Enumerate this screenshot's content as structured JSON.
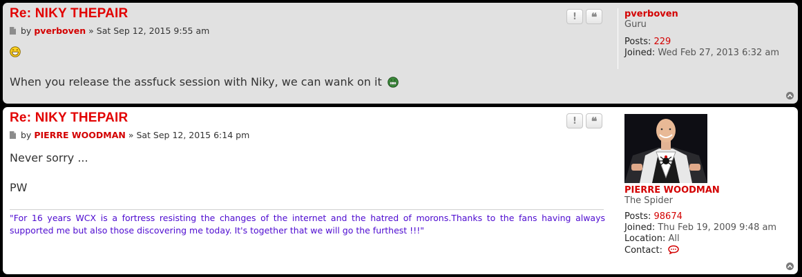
{
  "posts": [
    {
      "title": "Re: NIKY THEPAIR",
      "by": "by",
      "author": "pverboven",
      "date": "» Sat Sep 12, 2015 9:55 am",
      "content": [
        "When you release the assfuck session with Niky, we can wank on it"
      ],
      "profile": {
        "name": "pverboven",
        "rank": "Guru",
        "posts_label": "Posts:",
        "posts_value": "229",
        "joined_label": "Joined:",
        "joined_value": "Wed Feb 27, 2013 6:32 am"
      }
    },
    {
      "title": "Re: NIKY THEPAIR",
      "by": "by",
      "author": "PIERRE WOODMAN",
      "date": "» Sat Sep 12, 2015 6:14 pm",
      "content": [
        "Never sorry ...",
        "PW"
      ],
      "signature": "\"For 16 years WCX is a fortress resisting the changes of the internet and the hatred of morons.Thanks to the fans having always supported me but also those discovering me today. It's together that we will go the furthest !!!\"",
      "profile": {
        "name": "PIERRE WOODMAN",
        "rank": "The Spider",
        "posts_label": "Posts:",
        "posts_value": "98674",
        "joined_label": "Joined:",
        "joined_value": "Thu Feb 19, 2009 9:48 am",
        "location_label": "Location:",
        "location_value": "All",
        "contact_label": "Contact:"
      }
    }
  ],
  "buttons": {
    "report": "!",
    "quote": "❝"
  },
  "colors": {
    "accent": "#e20000",
    "signature": "#4d0ad0",
    "post1_bg": "#e1e1e1",
    "post2_bg": "#ffffff"
  },
  "icons": [
    "post-icon",
    "report-icon",
    "quote-icon",
    "smiley-icon",
    "grin-icon",
    "contact-icon",
    "back-to-top-icon"
  ]
}
